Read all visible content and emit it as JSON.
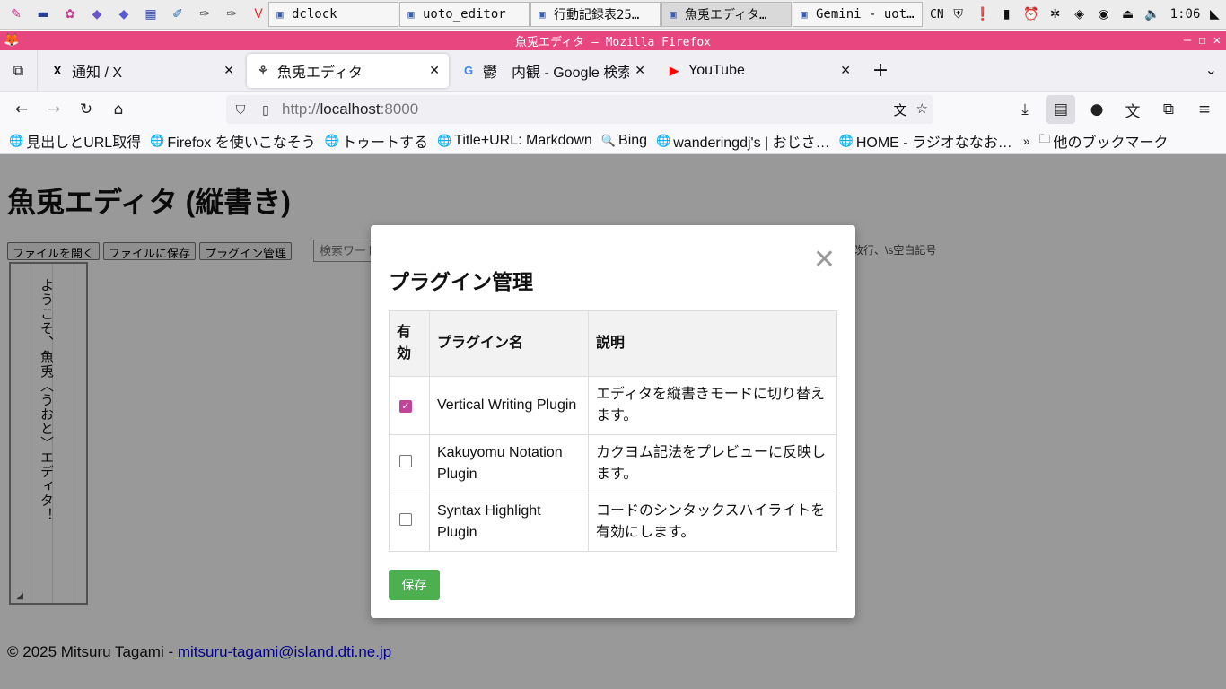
{
  "taskbar": {
    "launchers": [
      {
        "icon": "palette-icon",
        "glyph": "✎",
        "color": "#d0308a"
      },
      {
        "icon": "window-icon",
        "glyph": "▬",
        "color": "#2a3f8f"
      },
      {
        "icon": "flower-icon",
        "glyph": "✿",
        "color": "#c83a8c"
      },
      {
        "icon": "cube-icon",
        "glyph": "◆",
        "color": "#6b55c8"
      },
      {
        "icon": "cube-icon",
        "glyph": "◆",
        "color": "#5a5ad0"
      },
      {
        "icon": "chip-icon",
        "glyph": "▦",
        "color": "#3a4fb0"
      },
      {
        "icon": "editor-icon",
        "glyph": "✐",
        "color": "#2e70b8"
      },
      {
        "icon": "pen-icon",
        "glyph": "✑",
        "color": "#555555"
      },
      {
        "icon": "pen-icon",
        "glyph": "✑",
        "color": "#555555"
      },
      {
        "icon": "vivaldi-icon",
        "glyph": "V",
        "color": "#e03030"
      }
    ],
    "tasks": [
      {
        "label": "dclock",
        "icon": "window-icon",
        "active": false
      },
      {
        "label": "uoto_editor",
        "icon": "cube-icon",
        "active": false
      },
      {
        "label": "行動記録表25…",
        "icon": "spreadsheet-icon",
        "active": false
      },
      {
        "label": "魚兎エディタ…",
        "icon": "firefox-icon",
        "active": true
      },
      {
        "label": "Gemini - uot…",
        "icon": "chip-icon",
        "active": false
      }
    ],
    "lang": "CN",
    "clock": "1:06"
  },
  "titlebar": {
    "title": "魚兎エディタ — Mozilla Firefox"
  },
  "tabs": [
    {
      "title": "通知 / X",
      "favicon": "x-logo-icon",
      "glyph": "X",
      "color": "#000000",
      "selected": false
    },
    {
      "title": "魚兎エディタ",
      "favicon": "rabbit-icon",
      "glyph": "⚘",
      "color": "#444444",
      "selected": true
    },
    {
      "title": "鬱　内観 - Google 検索",
      "favicon": "google-icon",
      "glyph": "G",
      "color": "#4285f4",
      "selected": false
    },
    {
      "title": "YouTube",
      "favicon": "youtube-icon",
      "glyph": "▶",
      "color": "#ff0000",
      "selected": false
    }
  ],
  "navbar": {
    "url_scheme": "http://",
    "url_host": "localhost",
    "url_port": ":8000"
  },
  "bookmarks": [
    {
      "label": "見出しとURL取得",
      "icon": "globe-icon"
    },
    {
      "label": "Firefox を使いこなそう",
      "icon": "globe-icon"
    },
    {
      "label": "トゥートする",
      "icon": "globe-icon"
    },
    {
      "label": "Title+URL: Markdown",
      "icon": "globe-icon"
    },
    {
      "label": "Bing",
      "icon": "search-icon"
    },
    {
      "label": "wanderingdj's | おじさ…",
      "icon": "globe-icon"
    },
    {
      "label": "HOME - ラジオななお…",
      "icon": "globe-icon"
    }
  ],
  "bookmarks_other": "他のブックマーク",
  "page": {
    "title": "魚兎エディタ (縦書き)",
    "buttons": {
      "open": "ファイルを開く",
      "save": "ファイルに保存",
      "plugins": "プラグイン管理"
    },
    "search_placeholder": "検索ワード",
    "search_hint": "改行、\\s空白記号",
    "editor_text": "ようこそ、魚兎〈うおと〉エディタ！",
    "footer_text": "© 2025 Mitsuru Tagami - ",
    "footer_email": "mitsuru-tagami@island.dti.ne.jp"
  },
  "modal": {
    "title": "プラグイン管理",
    "close_glyph": "✕",
    "headers": {
      "enabled": "有効",
      "name": "プラグイン名",
      "description": "説明"
    },
    "plugins": [
      {
        "enabled": true,
        "name": "Vertical Writing Plugin",
        "description": "エディタを縦書きモードに切り替えます。"
      },
      {
        "enabled": false,
        "name": "Kakuyomu Notation Plugin",
        "description": "カクヨム記法をプレビューに反映します。"
      },
      {
        "enabled": false,
        "name": "Syntax Highlight Plugin",
        "description": "コードのシンタックスハイライトを有効にします。"
      }
    ],
    "save_label": "保存"
  },
  "colors": {
    "titlebar": "#e8467f",
    "save_button": "#4caf50",
    "checkbox_checked": "#c0449a",
    "overlay": "rgba(0,0,0,0.4)"
  }
}
